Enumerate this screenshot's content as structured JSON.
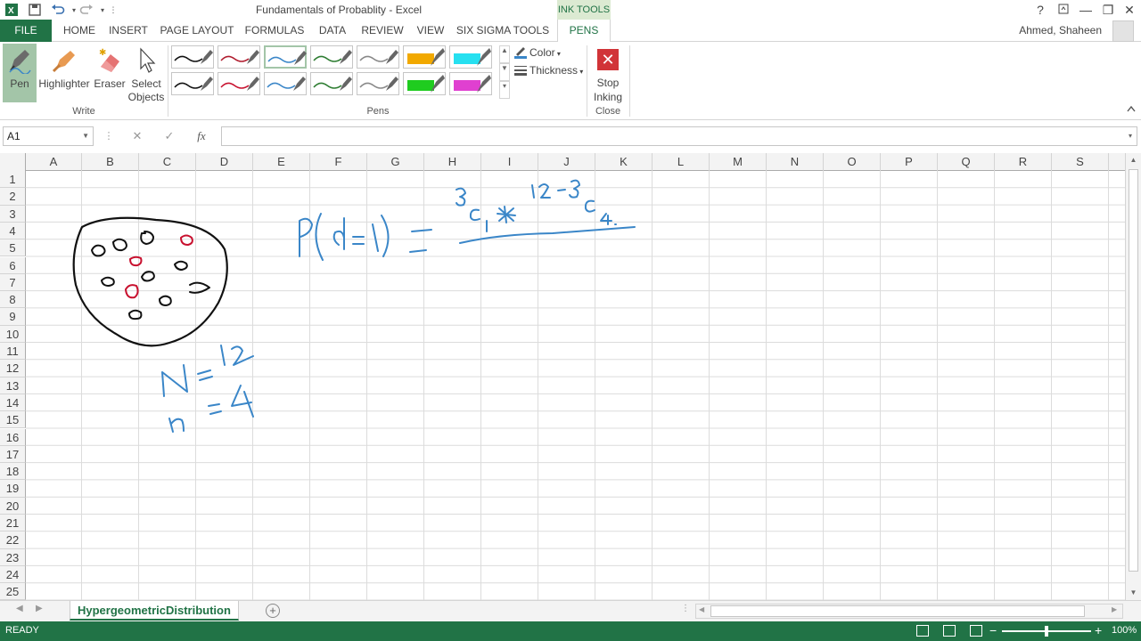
{
  "window": {
    "title": "Fundamentals of Probablity - Excel",
    "context_tab": "INK TOOLS",
    "help": "?",
    "user": "Ahmed, Shaheen"
  },
  "quick_access": {
    "excel_icon": "excel-logo-icon",
    "save_icon": "save-icon",
    "undo_icon": "undo-icon",
    "redo_icon": "redo-icon"
  },
  "tabs": [
    {
      "label": "FILE"
    },
    {
      "label": "HOME"
    },
    {
      "label": "INSERT"
    },
    {
      "label": "PAGE LAYOUT"
    },
    {
      "label": "FORMULAS"
    },
    {
      "label": "DATA"
    },
    {
      "label": "REVIEW"
    },
    {
      "label": "VIEW"
    },
    {
      "label": "SIX SIGMA TOOLS"
    },
    {
      "label": "PENS"
    }
  ],
  "ribbon": {
    "write": {
      "group_label": "Write",
      "pen_label": "Pen",
      "highlighter_label": "Highlighter",
      "eraser_label": "Eraser",
      "select_objects_label": "Select Objects"
    },
    "pens": {
      "group_label": "Pens",
      "color_label": "Color",
      "thickness_label": "Thickness",
      "swatches_row1": [
        "#111111",
        "#b01c2e",
        "#3a86c8",
        "#2e7d32",
        "#888888",
        "#f2a900",
        "#26e0f0"
      ],
      "swatches_row2": [
        "#111111",
        "#c8102e",
        "#3a86c8",
        "#2e7d32",
        "#888888",
        "#1fcc1f",
        "#e040d0"
      ],
      "selected_index": 2
    },
    "close": {
      "group_label": "Close",
      "stop_inking_label": "Stop Inking"
    }
  },
  "formula_bar": {
    "name_box": "A1",
    "cancel": "✕",
    "enter": "✓",
    "fx": "fx",
    "value": ""
  },
  "grid": {
    "columns": [
      "A",
      "B",
      "C",
      "D",
      "E",
      "F",
      "G",
      "H",
      "I",
      "J",
      "K",
      "L",
      "M",
      "N",
      "O",
      "P",
      "Q",
      "R",
      "S"
    ],
    "rows": [
      "1",
      "2",
      "3",
      "4",
      "5",
      "6",
      "7",
      "8",
      "9",
      "10",
      "11",
      "12",
      "13",
      "14",
      "15",
      "16",
      "17",
      "18",
      "19",
      "20",
      "21",
      "22",
      "23",
      "24",
      "25"
    ]
  },
  "sheet": {
    "active_tab": "HypergeometricDistribution"
  },
  "status": {
    "mode": "READY",
    "zoom": "100%"
  },
  "colors": {
    "excel_green": "#217346",
    "ink_blue": "#3a86c8",
    "ink_red": "#c8102e",
    "ink_black": "#111111"
  }
}
